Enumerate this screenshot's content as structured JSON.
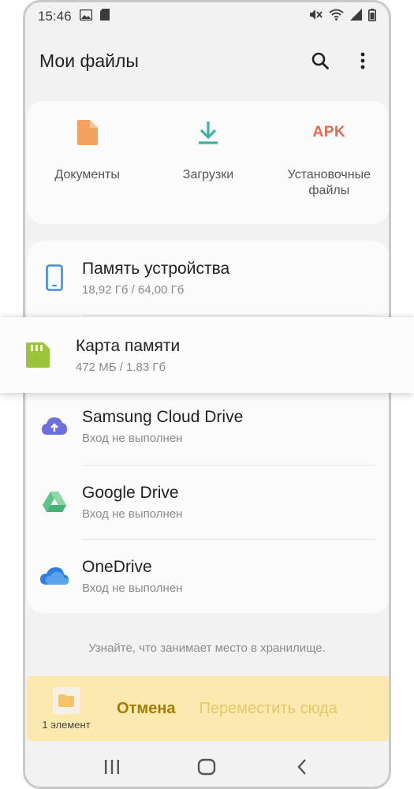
{
  "status_bar": {
    "time": "15:46",
    "icons_left": [
      "image-icon",
      "sim-card-icon"
    ],
    "icons_right": [
      "mute-icon",
      "wifi-icon",
      "signal-icon",
      "battery-icon"
    ]
  },
  "app_bar": {
    "title": "Мои файлы",
    "actions": [
      "search-icon",
      "more-vert-icon"
    ]
  },
  "categories": [
    {
      "label": "Документы",
      "icon": "document-icon",
      "color": "#f4a25f"
    },
    {
      "label": "Загрузки",
      "icon": "download-icon",
      "color": "#39b4a2"
    },
    {
      "label": "Установочные файлы",
      "icon_text": "APK",
      "color": "#e46a4f"
    }
  ],
  "storage": [
    {
      "title": "Память устройства",
      "subtitle": "18,92 Гб / 64,00 Гб",
      "icon": "phone-icon",
      "color": "#3f8de6"
    },
    {
      "title": "Карта памяти",
      "subtitle": "472 МБ / 1.83 Гб",
      "icon": "sd-card-icon",
      "color": "#9bc43a"
    },
    {
      "title": "Samsung Cloud Drive",
      "subtitle": "Вход не выполнен",
      "icon": "cloud-upload-icon",
      "color": "#6e6ee0"
    },
    {
      "title": "Google Drive",
      "subtitle": "Вход не выполнен",
      "icon": "google-drive-icon",
      "color": "#5fc48a"
    },
    {
      "title": "OneDrive",
      "subtitle": "Вход не выполнен",
      "icon": "onedrive-icon",
      "color": "#2f7fe0"
    }
  ],
  "hint": "Узнайте, что занимает место в хранилище.",
  "action_bar": {
    "selection_count": "1 элемент",
    "cancel_label": "Отмена",
    "move_label": "Переместить сюда",
    "cancel_color": "#a67c00",
    "move_color": "#e3c86b",
    "background": "#fbe9b0"
  },
  "nav_bar": [
    "recents-icon",
    "home-icon",
    "back-icon"
  ]
}
